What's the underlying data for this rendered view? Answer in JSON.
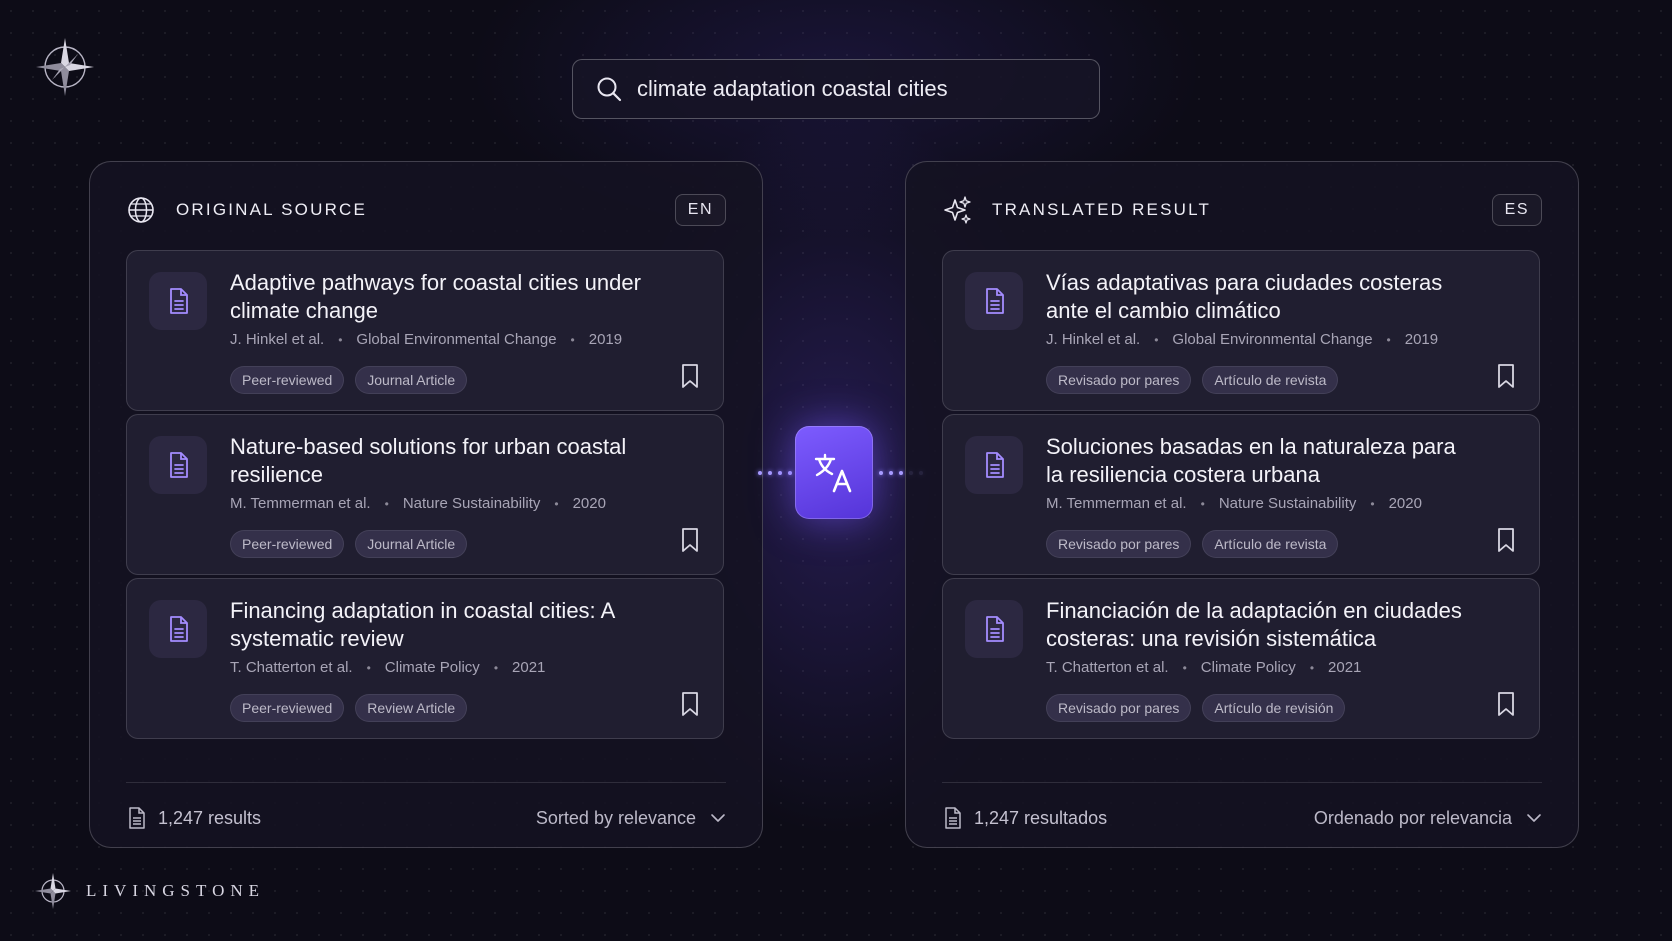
{
  "search": {
    "value": "climate adaptation coastal cities"
  },
  "brand": {
    "name": "LIVINGSTONE"
  },
  "colors": {
    "accent": "#6a48f0",
    "icon_accent": "#a48cff",
    "background": "#0d0c17"
  },
  "translate_button": {
    "icon": "translate-icon"
  },
  "left": {
    "title": "ORIGINAL SOURCE",
    "lang": "EN",
    "icon": "globe-icon",
    "results": [
      {
        "title": "Adaptive pathways for coastal cities under climate change",
        "authors": "J. Hinkel et al.",
        "journal": "Global Environmental Change",
        "year": "2019",
        "tags": [
          "Peer-reviewed",
          "Journal Article"
        ]
      },
      {
        "title": "Nature-based solutions for urban coastal resilience",
        "authors": "M. Temmerman et al.",
        "journal": "Nature Sustainability",
        "year": "2020",
        "tags": [
          "Peer-reviewed",
          "Journal Article"
        ]
      },
      {
        "title": "Financing adaptation in coastal cities: A systematic review",
        "authors": "T. Chatterton et al.",
        "journal": "Climate Policy",
        "year": "2021",
        "tags": [
          "Peer-reviewed",
          "Review Article"
        ]
      }
    ],
    "count": "1,247 results",
    "sort": "Sorted by relevance"
  },
  "right": {
    "title": "TRANSLATED RESULT",
    "lang": "ES",
    "icon": "sparkles-icon",
    "results": [
      {
        "title": "Vías adaptativas para ciudades costeras ante el cambio climático",
        "authors": "J. Hinkel et al.",
        "journal": "Global Environmental Change",
        "year": "2019",
        "tags": [
          "Revisado por pares",
          "Artículo de revista"
        ]
      },
      {
        "title": "Soluciones basadas en la naturaleza para la resiliencia costera urbana",
        "authors": "M. Temmerman et al.",
        "journal": "Nature Sustainability",
        "year": "2020",
        "tags": [
          "Revisado por pares",
          "Artículo de revista"
        ]
      },
      {
        "title": "Financiación de la adaptación en ciudades costeras: una revisión sistemática",
        "authors": "T. Chatterton et al.",
        "journal": "Climate Policy",
        "year": "2021",
        "tags": [
          "Revisado por pares",
          "Artículo de revisión"
        ]
      }
    ],
    "count": "1,247 resultados",
    "sort": "Ordenado por relevancia"
  }
}
